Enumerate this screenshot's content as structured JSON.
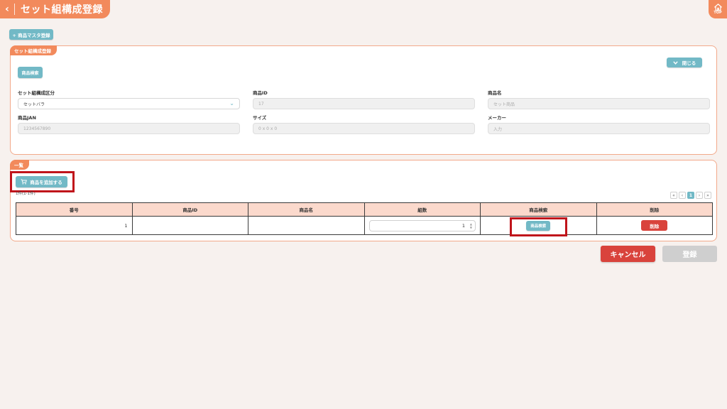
{
  "header": {
    "back_icon": "‹",
    "title": "セット組構成登録",
    "top_label": "TOP"
  },
  "toolbar": {
    "master_register_label": "+ 商品マスタ登録"
  },
  "form_panel": {
    "label": "セット組構成登録",
    "search_label": "商品検索",
    "close_label": "閉じる",
    "fields": {
      "set_type": {
        "label": "セット組構成区分",
        "value": "セットバラ"
      },
      "product_id": {
        "label": "商品ID",
        "placeholder": "17"
      },
      "product_name": {
        "label": "商品名",
        "placeholder": "セット商品"
      },
      "jan": {
        "label": "商品JAN",
        "placeholder": "1234567890"
      },
      "size": {
        "label": "サイズ",
        "placeholder": "0 x 0 x 0"
      },
      "maker": {
        "label": "メーカー",
        "placeholder": "入力"
      }
    }
  },
  "list_panel": {
    "label": "一覧",
    "add_label": "商品を追加する",
    "count_text": "1件(1-1件)",
    "pager": [
      "«",
      "‹",
      "1",
      "›",
      "»"
    ],
    "columns": [
      "番号",
      "商品ID",
      "商品名",
      "組数",
      "商品検索",
      "削除"
    ],
    "rows": [
      {
        "no": "1",
        "product_id": "",
        "product_name": "",
        "qty": "1",
        "search_label": "商品検索",
        "delete_label": "削除"
      }
    ]
  },
  "footer": {
    "cancel_label": "キャンセル",
    "register_label": "登録"
  },
  "colors": {
    "accent": "#f28a5c",
    "teal": "#72b9c6",
    "danger": "#d9433c",
    "highlight": "#c0141b"
  }
}
